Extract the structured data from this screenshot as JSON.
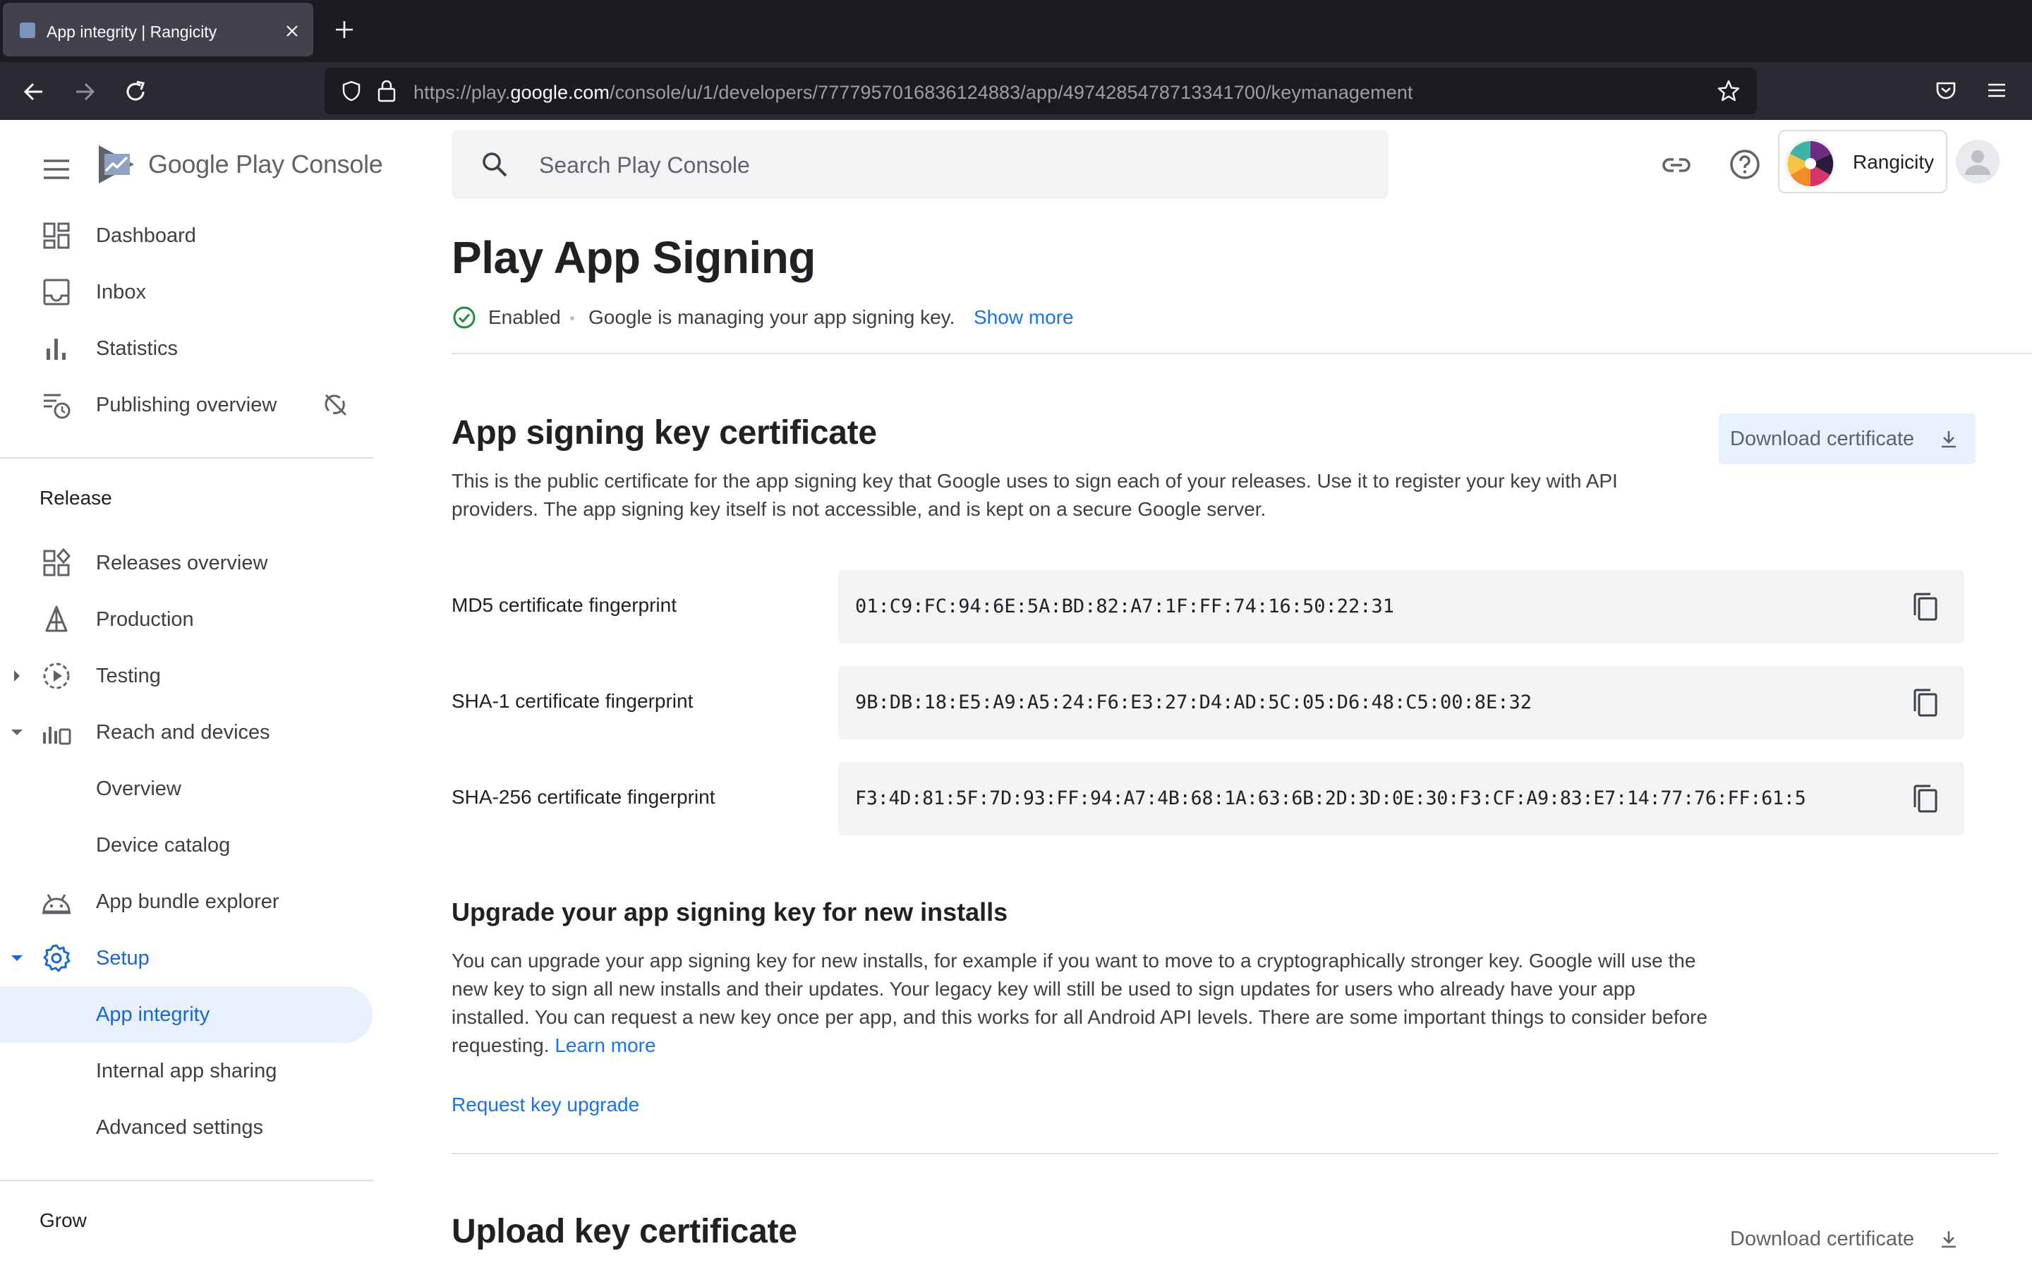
{
  "browser": {
    "tab_title": "App integrity | Rangicity",
    "url_prefix": "https://play.",
    "url_domain": "google.com",
    "url_path": "/console/u/1/developers/7777957016836124883/app/4974285478713341700/keymanagement"
  },
  "header": {
    "logo_text": "Google Play Console",
    "search_placeholder": "Search Play Console",
    "account_name": "Rangicity"
  },
  "sidebar": {
    "top_items": [
      {
        "label": "Dashboard",
        "icon": "dashboard-icon"
      },
      {
        "label": "Inbox",
        "icon": "inbox-icon"
      },
      {
        "label": "Statistics",
        "icon": "bar-chart-icon"
      },
      {
        "label": "Publishing overview",
        "icon": "publishing-overview-icon"
      }
    ],
    "release_title": "Release",
    "release_items": [
      {
        "label": "Releases overview",
        "icon": "releases-overview-icon"
      },
      {
        "label": "Production",
        "icon": "production-icon"
      },
      {
        "label": "Testing",
        "icon": "testing-icon"
      },
      {
        "label": "Reach and devices",
        "icon": "reach-devices-icon"
      },
      {
        "label": "Overview"
      },
      {
        "label": "Device catalog"
      },
      {
        "label": "App bundle explorer",
        "icon": "android-icon"
      },
      {
        "label": "Setup",
        "icon": "gear-icon"
      },
      {
        "label": "App integrity"
      },
      {
        "label": "Internal app sharing"
      },
      {
        "label": "Advanced settings"
      }
    ],
    "grow_title": "Grow"
  },
  "page": {
    "title": "Play App Signing",
    "status": "Enabled",
    "status_desc": "Google is managing your app signing key.",
    "status_link": "Show more"
  },
  "signing_cert": {
    "title": "App signing key certificate",
    "download_label": "Download certificate",
    "description": "This is the public certificate for the app signing key that Google uses to sign each of your releases. Use it to register your key with API providers. The app signing key itself is not accessible, and is kept on a secure Google server.",
    "fingerprints": [
      {
        "label": "MD5 certificate fingerprint",
        "value": "01:C9:FC:94:6E:5A:BD:82:A7:1F:FF:74:16:50:22:31"
      },
      {
        "label": "SHA-1 certificate fingerprint",
        "value": "9B:DB:18:E5:A9:A5:24:F6:E3:27:D4:AD:5C:05:D6:48:C5:00:8E:32"
      },
      {
        "label": "SHA-256 certificate fingerprint",
        "value": "F3:4D:81:5F:7D:93:FF:94:A7:4B:68:1A:63:6B:2D:3D:0E:30:F3:CF:A9:83:E7:14:77:76:FF:61:5"
      }
    ]
  },
  "upgrade": {
    "title": "Upgrade your app signing key for new installs",
    "description": "You can upgrade your app signing key for new installs, for example if you want to move to a cryptographically stronger key. Google will use the new key to sign all new installs and their updates. Your legacy key will still be used to sign updates for users who already have your app installed. You can request a new key once per app, and this works for all Android API levels. There are some important things to consider before requesting.",
    "learn_more": "Learn more",
    "request_link": "Request key upgrade"
  },
  "upload_cert": {
    "title": "Upload key certificate",
    "download_label": "Download certificate"
  },
  "colors": {
    "accent_blue": "#1a73e8",
    "active_nav_bg": "#e8f0fe",
    "status_green": "#1e8e3e"
  }
}
